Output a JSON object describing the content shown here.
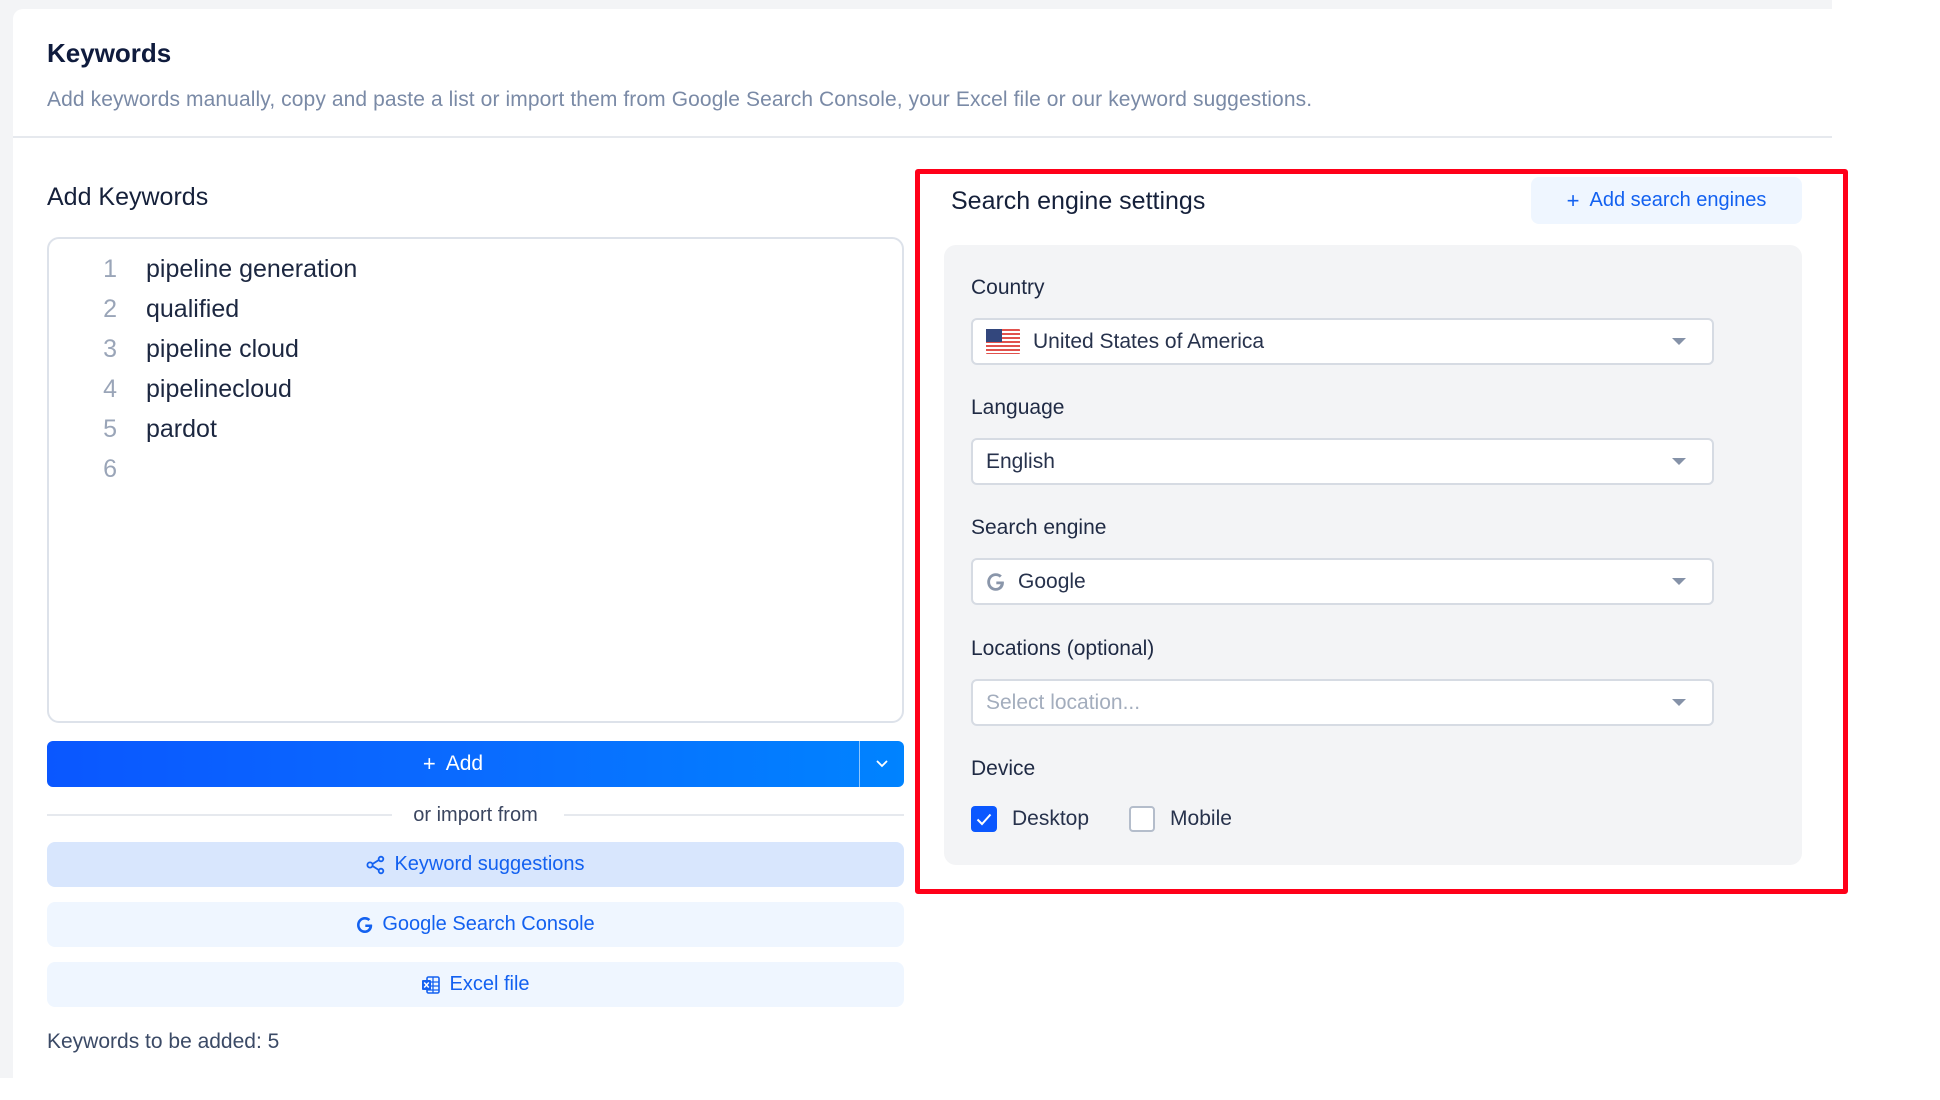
{
  "header": {
    "title": "Keywords",
    "description": "Add keywords manually, copy and paste a list or import them from Google Search Console, your Excel file or our keyword suggestions."
  },
  "add_keywords": {
    "title": "Add Keywords",
    "lines": [
      {
        "num": "1",
        "text": "pipeline generation"
      },
      {
        "num": "2",
        "text": "qualified"
      },
      {
        "num": "3",
        "text": "pipeline cloud"
      },
      {
        "num": "4",
        "text": "pipelinecloud"
      },
      {
        "num": "5",
        "text": "pardot"
      },
      {
        "num": "6",
        "text": ""
      }
    ],
    "add_button": {
      "icon": "plus-icon",
      "label": "Add",
      "dropdown_icon": "chevron-down-icon"
    },
    "import_divider": "or import from",
    "import_buttons": [
      {
        "icon": "share-nodes-icon",
        "label": "Keyword suggestions"
      },
      {
        "icon": "google-icon",
        "label": "Google Search Console"
      },
      {
        "icon": "excel-icon",
        "label": "Excel file"
      }
    ],
    "count_text": "Keywords to be added: 5"
  },
  "search_engine_settings": {
    "title": "Search engine settings",
    "add_button": {
      "icon": "plus-icon",
      "label": "Add search engines"
    },
    "fields": {
      "country": {
        "label": "Country",
        "value": "United States of America",
        "icon": "us-flag-icon"
      },
      "language": {
        "label": "Language",
        "value": "English"
      },
      "search_engine": {
        "label": "Search engine",
        "value": "Google",
        "icon": "google-icon"
      },
      "locations": {
        "label": "Locations (optional)",
        "placeholder": "Select location..."
      }
    },
    "device": {
      "label": "Device",
      "options": [
        {
          "label": "Desktop",
          "checked": true
        },
        {
          "label": "Mobile",
          "checked": false
        }
      ]
    }
  },
  "colors": {
    "primary": "#0a57ff",
    "link": "#1361f0",
    "highlight_border": "#ff0019",
    "panel_bg": "#f3f4f6"
  }
}
